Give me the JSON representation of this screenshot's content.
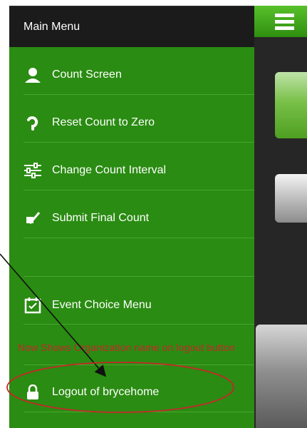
{
  "menu": {
    "header_title": "Main Menu",
    "items": [
      {
        "label": "Count Screen",
        "icon": "user-icon"
      },
      {
        "label": "Reset Count to Zero",
        "icon": "reset-icon"
      },
      {
        "label": "Change Count Interval",
        "icon": "sliders-icon"
      },
      {
        "label": "Submit Final Count",
        "icon": "checkbox-icon"
      },
      {
        "label": "Event Choice Menu",
        "icon": "calendar-icon"
      },
      {
        "label": "Logout of brycehome",
        "icon": "lock-icon"
      }
    ]
  },
  "annotation": {
    "text": "Now Shows Organization name on logout button",
    "color": "#c8262a"
  },
  "colors": {
    "menu_background": "#2a8c12",
    "header_background": "#1b1b1b",
    "toggle_green": "#4cae20",
    "content_background": "#262626"
  },
  "toggle": {
    "icon": "hamburger-icon"
  }
}
